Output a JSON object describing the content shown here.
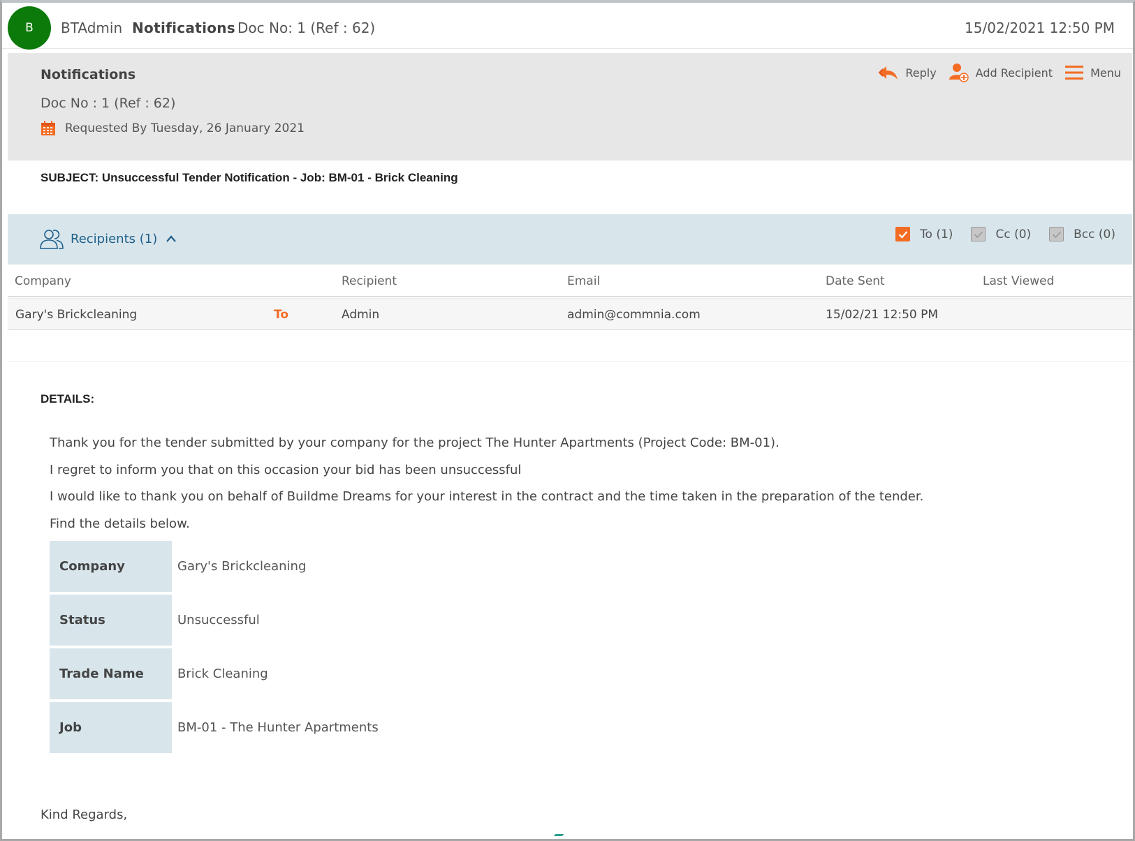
{
  "topbar": {
    "avatar_initial": "B",
    "user": "BTAdmin",
    "module": "Notifications",
    "doc": "Doc No: 1 (Ref : 62)",
    "datetime": "15/02/2021 12:50 PM"
  },
  "header": {
    "title": "Notifications",
    "doc": "Doc No : 1 (Ref : 62)",
    "requested": "Requested By Tuesday, 26 January 2021",
    "actions": {
      "reply": "Reply",
      "add_recipient": "Add Recipient",
      "menu": "Menu"
    }
  },
  "subject": "SUBJECT: Unsuccessful Tender Notification - Job: BM-01 - Brick Cleaning",
  "recipients": {
    "label": "Recipients (1)",
    "filters": {
      "to": "To (1)",
      "cc": "Cc (0)",
      "bcc": "Bcc (0)"
    },
    "columns": {
      "company": "Company",
      "recipient": "Recipient",
      "email": "Email",
      "date_sent": "Date Sent",
      "last_viewed": "Last Viewed"
    },
    "rows": [
      {
        "company": "Gary's Brickcleaning",
        "type": "To",
        "recipient": "Admin",
        "email": "admin@commnia.com",
        "date_sent": "15/02/21 12:50 PM",
        "last_viewed": ""
      }
    ]
  },
  "details": {
    "title": "DETAILS:",
    "paragraphs": [
      "Thank you for the tender submitted by your company for the project The Hunter Apartments (Project Code: BM-01).",
      "I regret to inform you that on this occasion your bid has been unsuccessful",
      "I would like to thank you on behalf of Buildme Dreams for your interest in the contract and the time taken in the preparation of the tender.",
      "Find the details below."
    ],
    "table": [
      {
        "key": "Company",
        "value": "Gary's Brickcleaning"
      },
      {
        "key": "Status",
        "value": "Unsuccessful"
      },
      {
        "key": "Trade Name",
        "value": "Brick Cleaning"
      },
      {
        "key": "Job",
        "value": "BM-01 - The Hunter Apartments"
      }
    ],
    "closing": "Kind Regards,"
  },
  "colors": {
    "accent": "#f26c24",
    "avatar": "#0b7a0b",
    "panel_gray": "#e7e7e7",
    "panel_blue": "#d8e6ec",
    "link_blue": "#1e5f8a"
  }
}
